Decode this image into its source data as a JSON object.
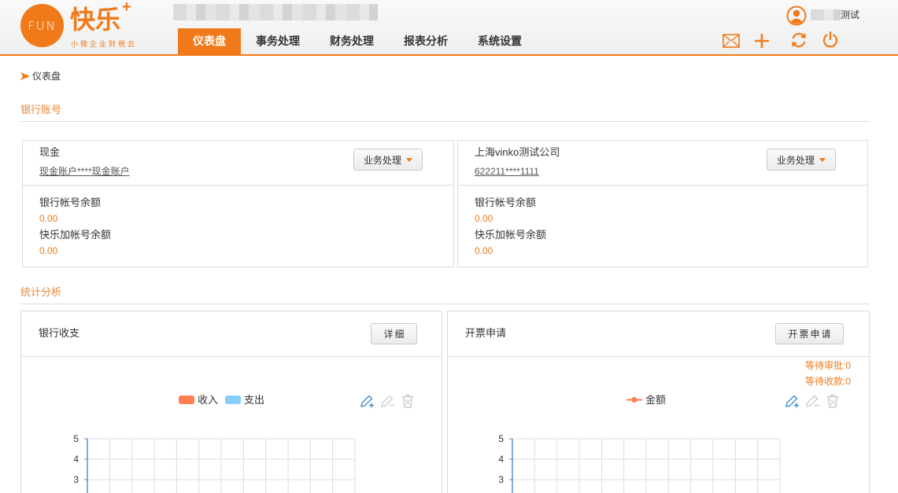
{
  "logo": {
    "mark_text": "FUN",
    "brand": "快乐",
    "brand_plus": "+",
    "slogan": "小微企业财税云"
  },
  "user": {
    "name_visible": "测试"
  },
  "nav": {
    "tabs": [
      {
        "label": "仪表盘",
        "active": true
      },
      {
        "label": "事务处理"
      },
      {
        "label": "财务处理"
      },
      {
        "label": "报表分析"
      },
      {
        "label": "系统设置"
      }
    ]
  },
  "toolbar_icons": [
    "mail-icon",
    "plus-icon",
    "refresh-icon",
    "power-icon"
  ],
  "breadcrumb": {
    "current": "仪表盘"
  },
  "bank_section": {
    "title": "银行账号",
    "cards": [
      {
        "name": "现金",
        "account": "现金账户****现金账户",
        "action_label": "业务处理",
        "balance_label": "银行帐号余额",
        "balance": "0.00",
        "kuaile_label": "快乐加帐号余额",
        "kuaile_balance": "0.00"
      },
      {
        "name": "上海vinko测试公司",
        "account": "622211****1111",
        "action_label": "业务处理",
        "balance_label": "银行帐号余额",
        "balance": "0.00",
        "kuaile_label": "快乐加帐号余额",
        "kuaile_balance": "0.00"
      }
    ]
  },
  "stats_section": {
    "title": "统计分析",
    "panels": [
      {
        "title": "银行收支",
        "button": "详细"
      },
      {
        "title": "开票申请",
        "button": "开票申请",
        "status": [
          "等待审批:0",
          "等待收款:0"
        ]
      }
    ]
  },
  "colors": {
    "accent": "#f07a1a",
    "accent_text": "#e8873a",
    "tool_active": "#3e8ed0",
    "tool_disabled": "#cccccc",
    "axis": "#5b8fd0"
  },
  "chart_data": [
    {
      "type": "bar",
      "series": [
        {
          "name": "收入",
          "color": "#ff7f50",
          "values": []
        },
        {
          "name": "支出",
          "color": "#87cefa",
          "values": []
        }
      ],
      "y_ticks": [
        5,
        4,
        3
      ],
      "ymax": 5,
      "grid": true,
      "legend": "top-center"
    },
    {
      "type": "line",
      "series": [
        {
          "name": "金额",
          "color": "#ff7f50",
          "values": []
        }
      ],
      "y_ticks": [
        5,
        4,
        3
      ],
      "ymax": 5,
      "grid": true,
      "legend": "top-center"
    }
  ]
}
